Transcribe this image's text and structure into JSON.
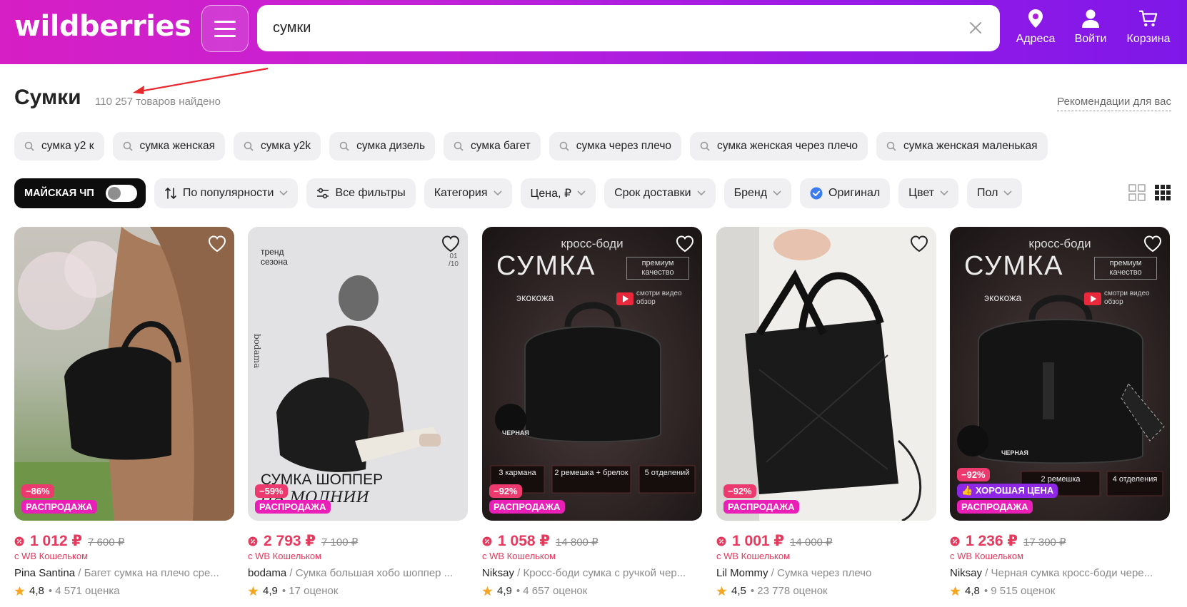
{
  "header": {
    "logo": "wildberries",
    "search_value": "сумки",
    "nav": [
      {
        "label": "Адреса",
        "icon": "location-pin-icon"
      },
      {
        "label": "Войти",
        "icon": "user-icon"
      },
      {
        "label": "Корзина",
        "icon": "cart-icon"
      }
    ]
  },
  "page": {
    "title": "Сумки",
    "count": "110 257 товаров найдено",
    "recommendations": "Рекомендации для вас"
  },
  "suggestions": [
    "сумка y2 к",
    "сумка женская",
    "сумка y2k",
    "сумка дизель",
    "сумка багет",
    "сумка через плечо",
    "сумка женская через плечо",
    "сумка женская маленькая"
  ],
  "filters": {
    "promo_label": "МАЙСКАЯ ЧП",
    "sort": "По популярности",
    "all_filters": "Все фильтры",
    "category": "Категория",
    "price": "Цена, ₽",
    "delivery": "Срок доставки",
    "brand": "Бренд",
    "original": "Оригинал",
    "color": "Цвет",
    "gender": "Пол"
  },
  "products": [
    {
      "discount": "−86%",
      "sale": "РАСПРОДАЖА",
      "price": "1 012 ₽",
      "old_price": "7 600 ₽",
      "wallet": "с WB Кошельком",
      "brand": "Pina Santina",
      "title": " / Багет сумка на плечо сре...",
      "rating": "4,8",
      "reviews": "• 4 571 оценка"
    },
    {
      "photo_line1": "тренд",
      "photo_line2": "сезона",
      "photo_counter": "01 /10",
      "photo_caption": "СУМКА ШОППЕР",
      "photo_caption2": "НА МОЛНИИ",
      "photo_brand": "bodama",
      "discount": "−59%",
      "sale": "РАСПРОДАЖА",
      "price": "2 793 ₽",
      "old_price": "7 100 ₽",
      "wallet": "с WB Кошельком",
      "brand": "bodama",
      "title": " / Сумка большая хобо шоппер ...",
      "rating": "4,9",
      "reviews": "• 17 оценок"
    },
    {
      "photo_top": "кросс-боди",
      "photo_big": "СУМКА",
      "photo_premium": "премиум качество",
      "photo_leather": "экокожа",
      "photo_video": "смотри видео обзор",
      "photo_black": "ЧЕРНАЯ",
      "photo_f1": "3 кармана",
      "photo_f2": "2 ремешка + брелок",
      "photo_f3": "5 отделений",
      "discount": "−92%",
      "sale": "РАСПРОДАЖА",
      "price": "1 058 ₽",
      "old_price": "14 800 ₽",
      "wallet": "с WB Кошельком",
      "brand": "Niksay",
      "title": " / Кросс-боди сумка с ручкой чер...",
      "rating": "4,9",
      "reviews": "• 4 657 оценок"
    },
    {
      "discount": "−92%",
      "sale": "РАСПРОДАЖА",
      "price": "1 001 ₽",
      "old_price": "14 000 ₽",
      "wallet": "с WB Кошельком",
      "brand": "Lil Mommy",
      "title": " / Сумка через плечо",
      "rating": "4,5",
      "reviews": "• 23 778 оценок"
    },
    {
      "photo_top": "кросс-боди",
      "photo_big": "СУМКА",
      "photo_premium": "премиум качество",
      "photo_leather": "экокожа",
      "photo_video": "смотри видео обзор",
      "photo_black": "ЧЕРНАЯ",
      "photo_f2": "2 ремешка",
      "photo_f3": "4 отделения",
      "discount": "−92%",
      "good": "ХОРОШАЯ ЦЕНА",
      "sale": "РАСПРОДАЖА",
      "price": "1 236 ₽",
      "old_price": "17 300 ₽",
      "wallet": "с WB Кошельком",
      "brand": "Niksay",
      "title": " / Черная сумка кросс-боди чере...",
      "rating": "4,8",
      "reviews": "• 9 515 оценок"
    }
  ],
  "colors": {
    "accent_pink": "#cb11ab",
    "accent_purple": "#7e18e8",
    "price_red": "#e53a5e",
    "star": "#f5a623"
  }
}
